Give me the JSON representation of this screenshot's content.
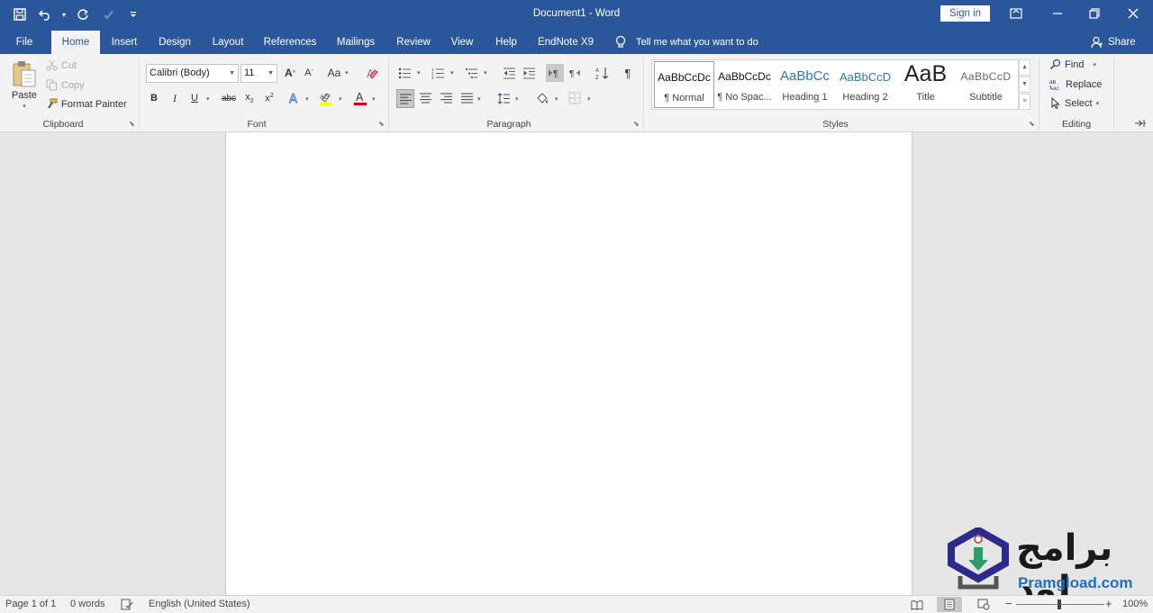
{
  "app": {
    "title": "Document1  -  Word"
  },
  "titlebar": {
    "signin_label": "Sign in"
  },
  "tabs": [
    "File",
    "Home",
    "Insert",
    "Design",
    "Layout",
    "References",
    "Mailings",
    "Review",
    "View",
    "Help",
    "EndNote X9"
  ],
  "active_tab": "Home",
  "tell_me": "Tell me what you want to do",
  "share_label": "Share",
  "clipboard": {
    "paste": "Paste",
    "cut": "Cut",
    "copy": "Copy",
    "format_painter": "Format Painter",
    "group": "Clipboard"
  },
  "font": {
    "name": "Calibri (Body)",
    "size": "11",
    "group": "Font",
    "change_case": "Aa"
  },
  "paragraph": {
    "group": "Paragraph"
  },
  "styles": {
    "group": "Styles",
    "items": [
      {
        "preview": "AaBbCcDc",
        "name": "¶ Normal"
      },
      {
        "preview": "AaBbCcDc",
        "name": "¶ No Spac..."
      },
      {
        "preview": "AaBbCc",
        "name": "Heading 1"
      },
      {
        "preview": "AaBbCcD",
        "name": "Heading 2"
      },
      {
        "preview": "AaB",
        "name": "Title"
      },
      {
        "preview": "AaBbCcD",
        "name": "Subtitle"
      }
    ]
  },
  "editing": {
    "find": "Find",
    "replace": "Replace",
    "select": "Select",
    "group": "Editing"
  },
  "status": {
    "page": "Page 1 of 1",
    "words": "0 words",
    "language": "English (United States)",
    "zoom": "100%",
    "zoom_minus": "−",
    "zoom_plus": "+"
  },
  "watermark": {
    "arabic": "برامج لود",
    "latin": "Pramgload.com"
  },
  "colors": {
    "brand": "#2b579a",
    "ribbon": "#f3f3f3",
    "workspace": "#e6e6e6",
    "highlight": "#ffff00",
    "font_color": "#c00000"
  }
}
